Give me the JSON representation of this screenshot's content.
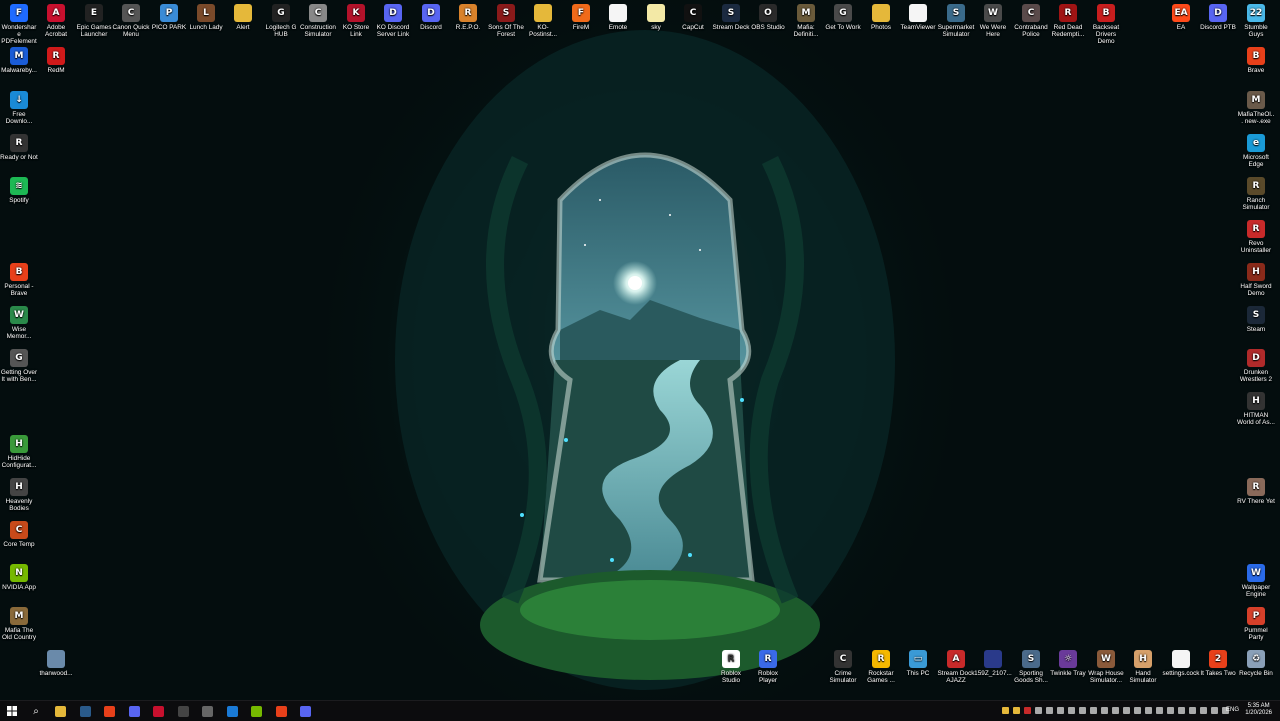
{
  "desktop": {
    "top_row": [
      {
        "label": "Wondershare PDFelement",
        "icon": "pdf-icon",
        "color": "#1f6bff",
        "glyph": "F"
      },
      {
        "label": "Adobe Acrobat",
        "icon": "acrobat-icon",
        "color": "#c8102e",
        "glyph": "A"
      },
      {
        "label": "Epic Games Launcher",
        "icon": "epic-icon",
        "color": "#222222",
        "glyph": "E"
      },
      {
        "label": "Canon Quick Menu",
        "icon": "canon-icon",
        "color": "#555555",
        "glyph": "C"
      },
      {
        "label": "PICO PARK",
        "icon": "game-icon",
        "color": "#3a8bd6",
        "glyph": "P"
      },
      {
        "label": "Lunch Lady",
        "icon": "game-icon",
        "color": "#7a4a2a",
        "glyph": "L"
      },
      {
        "label": "Alert",
        "icon": "folder-icon",
        "color": "#e5b83a",
        "glyph": ""
      },
      {
        "label": "Logitech G HUB",
        "icon": "logitech-icon",
        "color": "#222222",
        "glyph": "G"
      },
      {
        "label": "Construction Simulator",
        "icon": "game-icon",
        "color": "#888888",
        "glyph": "C"
      },
      {
        "label": "KO Store Link",
        "icon": "link-icon",
        "color": "#b3122a",
        "glyph": "K"
      },
      {
        "label": "KO Discord Server Link",
        "icon": "discord-icon",
        "color": "#5865f2",
        "glyph": "D"
      },
      {
        "label": "Discord",
        "icon": "discord-icon",
        "color": "#5865f2",
        "glyph": "D"
      },
      {
        "label": "R.E.P.O.",
        "icon": "game-icon",
        "color": "#d9822b",
        "glyph": "R"
      },
      {
        "label": "Sons Of The Forest",
        "icon": "game-icon",
        "color": "#8a1a1a",
        "glyph": "S"
      },
      {
        "label": "KO-Postinst...",
        "icon": "folder-icon",
        "color": "#e5b83a",
        "glyph": ""
      },
      {
        "label": "FireM",
        "icon": "app-icon",
        "color": "#f06a1a",
        "glyph": "F"
      },
      {
        "label": "Emote",
        "icon": "file-icon",
        "color": "#f5f5f5",
        "glyph": ""
      },
      {
        "label": "sky",
        "icon": "file-icon",
        "color": "#f3e9a6",
        "glyph": ""
      },
      {
        "label": "CapCut",
        "icon": "capcut-icon",
        "color": "#111111",
        "glyph": "C"
      },
      {
        "label": "Stream Deck",
        "icon": "streamdeck-icon",
        "color": "#1b2a40",
        "glyph": "S"
      },
      {
        "label": "OBS Studio",
        "icon": "obs-icon",
        "color": "#2a2a2a",
        "glyph": "O"
      },
      {
        "label": "Mafia: Definiti...",
        "icon": "game-icon",
        "color": "#6a5a3a",
        "glyph": "M"
      },
      {
        "label": "Get To Work",
        "icon": "game-icon",
        "color": "#4a4a4a",
        "glyph": "G"
      },
      {
        "label": "Photos",
        "icon": "folder-icon",
        "color": "#e5b83a",
        "glyph": ""
      },
      {
        "label": "TeamViewer",
        "icon": "file-icon",
        "color": "#f5f5f5",
        "glyph": ""
      },
      {
        "label": "Supermarket Simulator",
        "icon": "game-icon",
        "color": "#3a6a8a",
        "glyph": "S"
      },
      {
        "label": "We Were Here",
        "icon": "game-icon",
        "color": "#4a4a4a",
        "glyph": "W"
      },
      {
        "label": "Contraband Police",
        "icon": "game-icon",
        "color": "#5a4a4a",
        "glyph": "C"
      },
      {
        "label": "Red Dead Redempti...",
        "icon": "game-icon",
        "color": "#a01414",
        "glyph": "R"
      },
      {
        "label": "Backseat Drivers Demo",
        "icon": "game-icon",
        "color": "#c81e1e",
        "glyph": "B"
      },
      {
        "label": "EA",
        "icon": "ea-icon",
        "color": "#ff4a1a",
        "glyph": "EA"
      },
      {
        "label": "Discord PTB",
        "icon": "discord-icon",
        "color": "#5865f2",
        "glyph": "D"
      },
      {
        "label": "Stumble Guys",
        "icon": "game-icon",
        "color": "#4ab8e8",
        "glyph": "22"
      }
    ],
    "left_column": [
      {
        "label": "Malwareby...",
        "icon": "malwarebytes-icon",
        "color": "#1a5cd6",
        "glyph": "M"
      },
      {
        "label": "RedM",
        "icon": "game-icon",
        "color": "#d01a1a",
        "glyph": "R"
      },
      {
        "label": "Free Downlo...",
        "icon": "download-icon",
        "color": "#1a8ad6",
        "glyph": "↓"
      },
      {
        "label": "Ready or Not",
        "icon": "game-icon",
        "color": "#333333",
        "glyph": "R"
      },
      {
        "label": "Spotify",
        "icon": "spotify-icon",
        "color": "#1db954",
        "glyph": "≋"
      },
      {
        "label": "Personal - Brave",
        "icon": "brave-icon",
        "color": "#e8401a",
        "glyph": "B"
      },
      {
        "label": "Wise Memor...",
        "icon": "app-icon",
        "color": "#2a8a4a",
        "glyph": "W"
      },
      {
        "label": "Getting Over It with Ben...",
        "icon": "game-icon",
        "color": "#555555",
        "glyph": "G"
      },
      {
        "label": "HidHide Configurat...",
        "icon": "app-icon",
        "color": "#3a9a3a",
        "glyph": "H"
      },
      {
        "label": "Heavenly Bodies",
        "icon": "game-icon",
        "color": "#444444",
        "glyph": "H"
      },
      {
        "label": "Core Temp",
        "icon": "app-icon",
        "color": "#c84a1a",
        "glyph": "C"
      },
      {
        "label": "NVIDIA App",
        "icon": "nvidia-icon",
        "color": "#76b900",
        "glyph": "N"
      },
      {
        "label": "Mafia The Old Country",
        "icon": "game-icon",
        "color": "#8a6a3a",
        "glyph": "M"
      },
      {
        "label": "thanwood...",
        "icon": "monitor-icon",
        "color": "#6a8aaa",
        "glyph": ""
      }
    ],
    "right_column": [
      {
        "label": "Brave",
        "icon": "brave-icon",
        "color": "#e8401a",
        "glyph": "B"
      },
      {
        "label": "MafiaTheOl... new-.exe",
        "icon": "game-icon",
        "color": "#6a5a4a",
        "glyph": "M"
      },
      {
        "label": "Microsoft Edge",
        "icon": "edge-icon",
        "color": "#1a9ad6",
        "glyph": "e"
      },
      {
        "label": "Ranch Simulator",
        "icon": "game-icon",
        "color": "#5a4a2a",
        "glyph": "R"
      },
      {
        "label": "Revo Uninstaller",
        "icon": "app-icon",
        "color": "#c82a2a",
        "glyph": "R"
      },
      {
        "label": "Half Sword Demo",
        "icon": "game-icon",
        "color": "#8a2a1a",
        "glyph": "H"
      },
      {
        "label": "Steam",
        "icon": "steam-icon",
        "color": "#1b2838",
        "glyph": "S"
      },
      {
        "label": "Drunken Wrestlers 2",
        "icon": "game-icon",
        "color": "#b02a2a",
        "glyph": "D"
      },
      {
        "label": "HITMAN World of As...",
        "icon": "game-icon",
        "color": "#333333",
        "glyph": "H"
      },
      {
        "label": "RV There Yet",
        "icon": "game-icon",
        "color": "#8a6a5a",
        "glyph": "R"
      },
      {
        "label": "Wallpaper Engine",
        "icon": "app-icon",
        "color": "#2a6ae8",
        "glyph": "W"
      },
      {
        "label": "Pummel Party",
        "icon": "game-icon",
        "color": "#d6402a",
        "glyph": "P"
      },
      {
        "label": "Recycle Bin",
        "icon": "recycle-bin-icon",
        "color": "#8aa0b8",
        "glyph": "♻"
      }
    ],
    "bottom_row": [
      {
        "label": "Roblox Studio",
        "icon": "roblox-icon",
        "color": "#ffffff",
        "glyph": "R"
      },
      {
        "label": "Roblox Player",
        "icon": "roblox-icon",
        "color": "#3a6ae8",
        "glyph": "R"
      },
      {
        "label": "Crime Simulator",
        "icon": "game-icon",
        "color": "#333333",
        "glyph": "C"
      },
      {
        "label": "Rockstar Games ...",
        "icon": "rockstar-icon",
        "color": "#f5b800",
        "glyph": "R"
      },
      {
        "label": "This PC",
        "icon": "computer-icon",
        "color": "#3a9ad6",
        "glyph": "▭"
      },
      {
        "label": "Stream Dock AJAZZ",
        "icon": "app-icon",
        "color": "#c82a2a",
        "glyph": "A"
      },
      {
        "label": "159Z_2107...",
        "icon": "file-icon",
        "color": "#2a3a8a",
        "glyph": ""
      },
      {
        "label": "Sporting Goods Sh...",
        "icon": "game-icon",
        "color": "#4a6a8a",
        "glyph": "S"
      },
      {
        "label": "Twinkle Tray",
        "icon": "app-icon",
        "color": "#6a3a9a",
        "glyph": "☼"
      },
      {
        "label": "Wrap House Simulator...",
        "icon": "game-icon",
        "color": "#8a5a3a",
        "glyph": "W"
      },
      {
        "label": "Hand Simulator",
        "icon": "game-icon",
        "color": "#d6a06a",
        "glyph": "H"
      },
      {
        "label": "settings.cock",
        "icon": "file-icon",
        "color": "#f5f5f5",
        "glyph": ""
      },
      {
        "label": "It Takes Two",
        "icon": "game-icon",
        "color": "#e8401a",
        "glyph": "2"
      }
    ]
  },
  "taskbar": {
    "start_icon": "windows-icon",
    "pinned": [
      {
        "name": "search-icon",
        "color": "",
        "glyph": "⌕"
      },
      {
        "name": "file-explorer-icon",
        "color": "#e5b83a",
        "glyph": ""
      },
      {
        "name": "steam-icon",
        "color": "#2a5a8a",
        "glyph": ""
      },
      {
        "name": "brave-icon",
        "color": "#e8401a",
        "glyph": ""
      },
      {
        "name": "discord-icon",
        "color": "#5865f2",
        "glyph": ""
      },
      {
        "name": "acrobat-icon",
        "color": "#c8102e",
        "glyph": ""
      },
      {
        "name": "obs-icon",
        "color": "#444444",
        "glyph": ""
      },
      {
        "name": "settings-icon",
        "color": "#666666",
        "glyph": ""
      },
      {
        "name": "edge-icon",
        "color": "#1a7ad6",
        "glyph": ""
      },
      {
        "name": "nvidia-icon",
        "color": "#76b900",
        "glyph": ""
      },
      {
        "name": "brave-icon",
        "color": "#e8401a",
        "glyph": ""
      },
      {
        "name": "discord-icon",
        "color": "#5865f2",
        "glyph": ""
      }
    ],
    "tray_colors": [
      "#e5b83a",
      "#e5b83a",
      "#c82a2a",
      "#aaaaaa",
      "#aaaaaa",
      "#aaaaaa",
      "#aaaaaa",
      "#aaaaaa",
      "#aaaaaa",
      "#aaaaaa",
      "#aaaaaa",
      "#aaaaaa",
      "#aaaaaa",
      "#aaaaaa",
      "#aaaaaa",
      "#aaaaaa",
      "#aaaaaa",
      "#aaaaaa",
      "#aaaaaa",
      "#aaaaaa",
      "#aaaaaa"
    ],
    "language": "ENG",
    "time": "5:35 AM",
    "date": "1/20/2026"
  }
}
